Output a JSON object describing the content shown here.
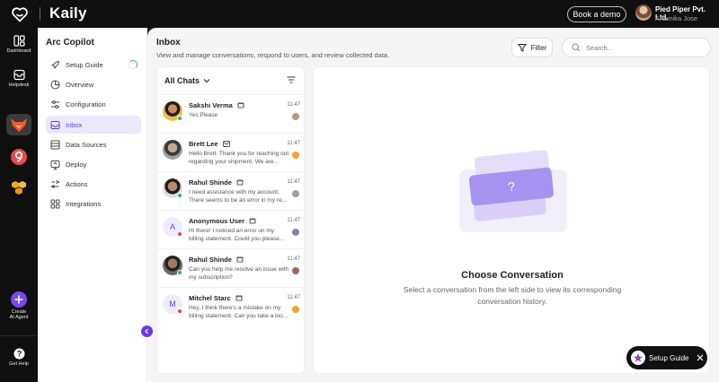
{
  "app": {
    "name": "Kaily"
  },
  "topbar": {
    "book_demo": "Book a demo",
    "org_name": "Pied Piper Pvt. Ltd.",
    "user_name": "Anamika Jose"
  },
  "rail": {
    "dashboard": "Dashboard",
    "helpdesk": "Helpdesk",
    "create_agent_1": "Create",
    "create_agent_2": "AI Agent",
    "help": "Get Help"
  },
  "sidebar": {
    "title": "Arc Copilot",
    "items": [
      {
        "label": "Setup Guide",
        "icon": "rocket-icon"
      },
      {
        "label": "Overview",
        "icon": "pie-chart-icon"
      },
      {
        "label": "Configuration",
        "icon": "sliders-icon"
      },
      {
        "label": "Inbox",
        "icon": "inbox-icon"
      },
      {
        "label": "Data Sources",
        "icon": "database-icon"
      },
      {
        "label": "Deploy",
        "icon": "deploy-icon"
      },
      {
        "label": "Actions",
        "icon": "actions-icon"
      },
      {
        "label": "Integrations",
        "icon": "integrations-icon"
      }
    ],
    "active": "Inbox"
  },
  "inbox": {
    "title": "Inbox",
    "subtitle": "View and manage conversations, respond to users, and review collected data.",
    "filter_label": "Filter",
    "search_placeholder": "Search.."
  },
  "chat_list": {
    "header": "All Chats",
    "chats": [
      {
        "name": "Sakshi Verma",
        "time": "11:47",
        "message": "Yes Please",
        "status": "online",
        "channel": "web"
      },
      {
        "name": "Brett Lee",
        "time": "11:47",
        "message": "Hello Brett. Thank you for reaching out regarding your shipment. We are...",
        "status": "none",
        "channel": "email"
      },
      {
        "name": "Rahul Shinde",
        "time": "11:47",
        "message": "I need assistance with my account. There seems to be an error in my re...",
        "status": "online",
        "channel": "web"
      },
      {
        "name": "Anonymous User",
        "time": "11:47",
        "message": "Hi there! I noticed an error on my billing statement. Could you please...",
        "status": "offline",
        "channel": "web",
        "initial": "A"
      },
      {
        "name": "Rahul Shinde",
        "time": "11:47",
        "message": " Can you help me resolve an issue with my subscription?",
        "status": "online",
        "channel": "web"
      },
      {
        "name": "Mitchel Starc",
        "time": "11:47",
        "message": "Hey, I think there's a mistake on my billing statement. Can you take a loo...",
        "status": "offline",
        "channel": "web",
        "initial": "M"
      }
    ]
  },
  "conversation": {
    "empty_title": "Choose Conversation",
    "empty_subtitle": "Select a conversation from the left side to view its corresponding conversation history."
  },
  "setup_pill": {
    "label": "Setup Guide"
  },
  "colors": {
    "accent": "#6b3ce6",
    "online": "#2eb267",
    "offline": "#e0434f",
    "rail_bg": "#0f0f0f"
  }
}
